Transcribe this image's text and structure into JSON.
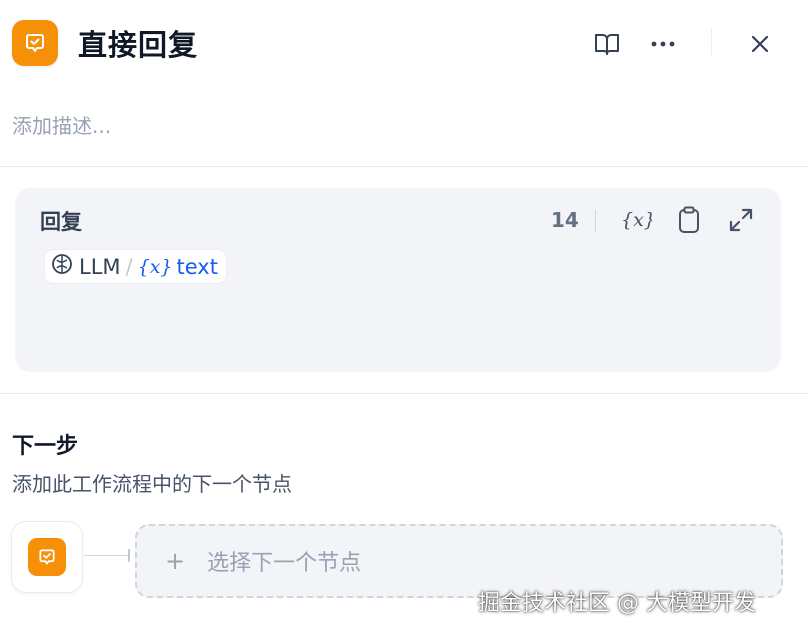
{
  "header": {
    "title": "直接回复",
    "description_placeholder": "添加描述..."
  },
  "reply": {
    "label": "回复",
    "char_count": "14",
    "chip": {
      "node": "LLM",
      "separator": "/",
      "variable_icon": "{x}",
      "variable": "text"
    }
  },
  "next_step": {
    "title": "下一步",
    "description": "添加此工作流程中的下一个节点",
    "select_plus": "+",
    "select_label": "选择下一个节点"
  },
  "watermark": "掘金技术社区 @ 大模型开发",
  "colors": {
    "accent_orange": "#f79009",
    "variable_blue": "#155eef",
    "card_bg": "#f2f4f7"
  },
  "icons": [
    "reply-node-icon",
    "book-icon",
    "more-icon",
    "close-icon",
    "variable-icon",
    "clipboard-icon",
    "expand-icon",
    "llm-node-icon"
  ]
}
